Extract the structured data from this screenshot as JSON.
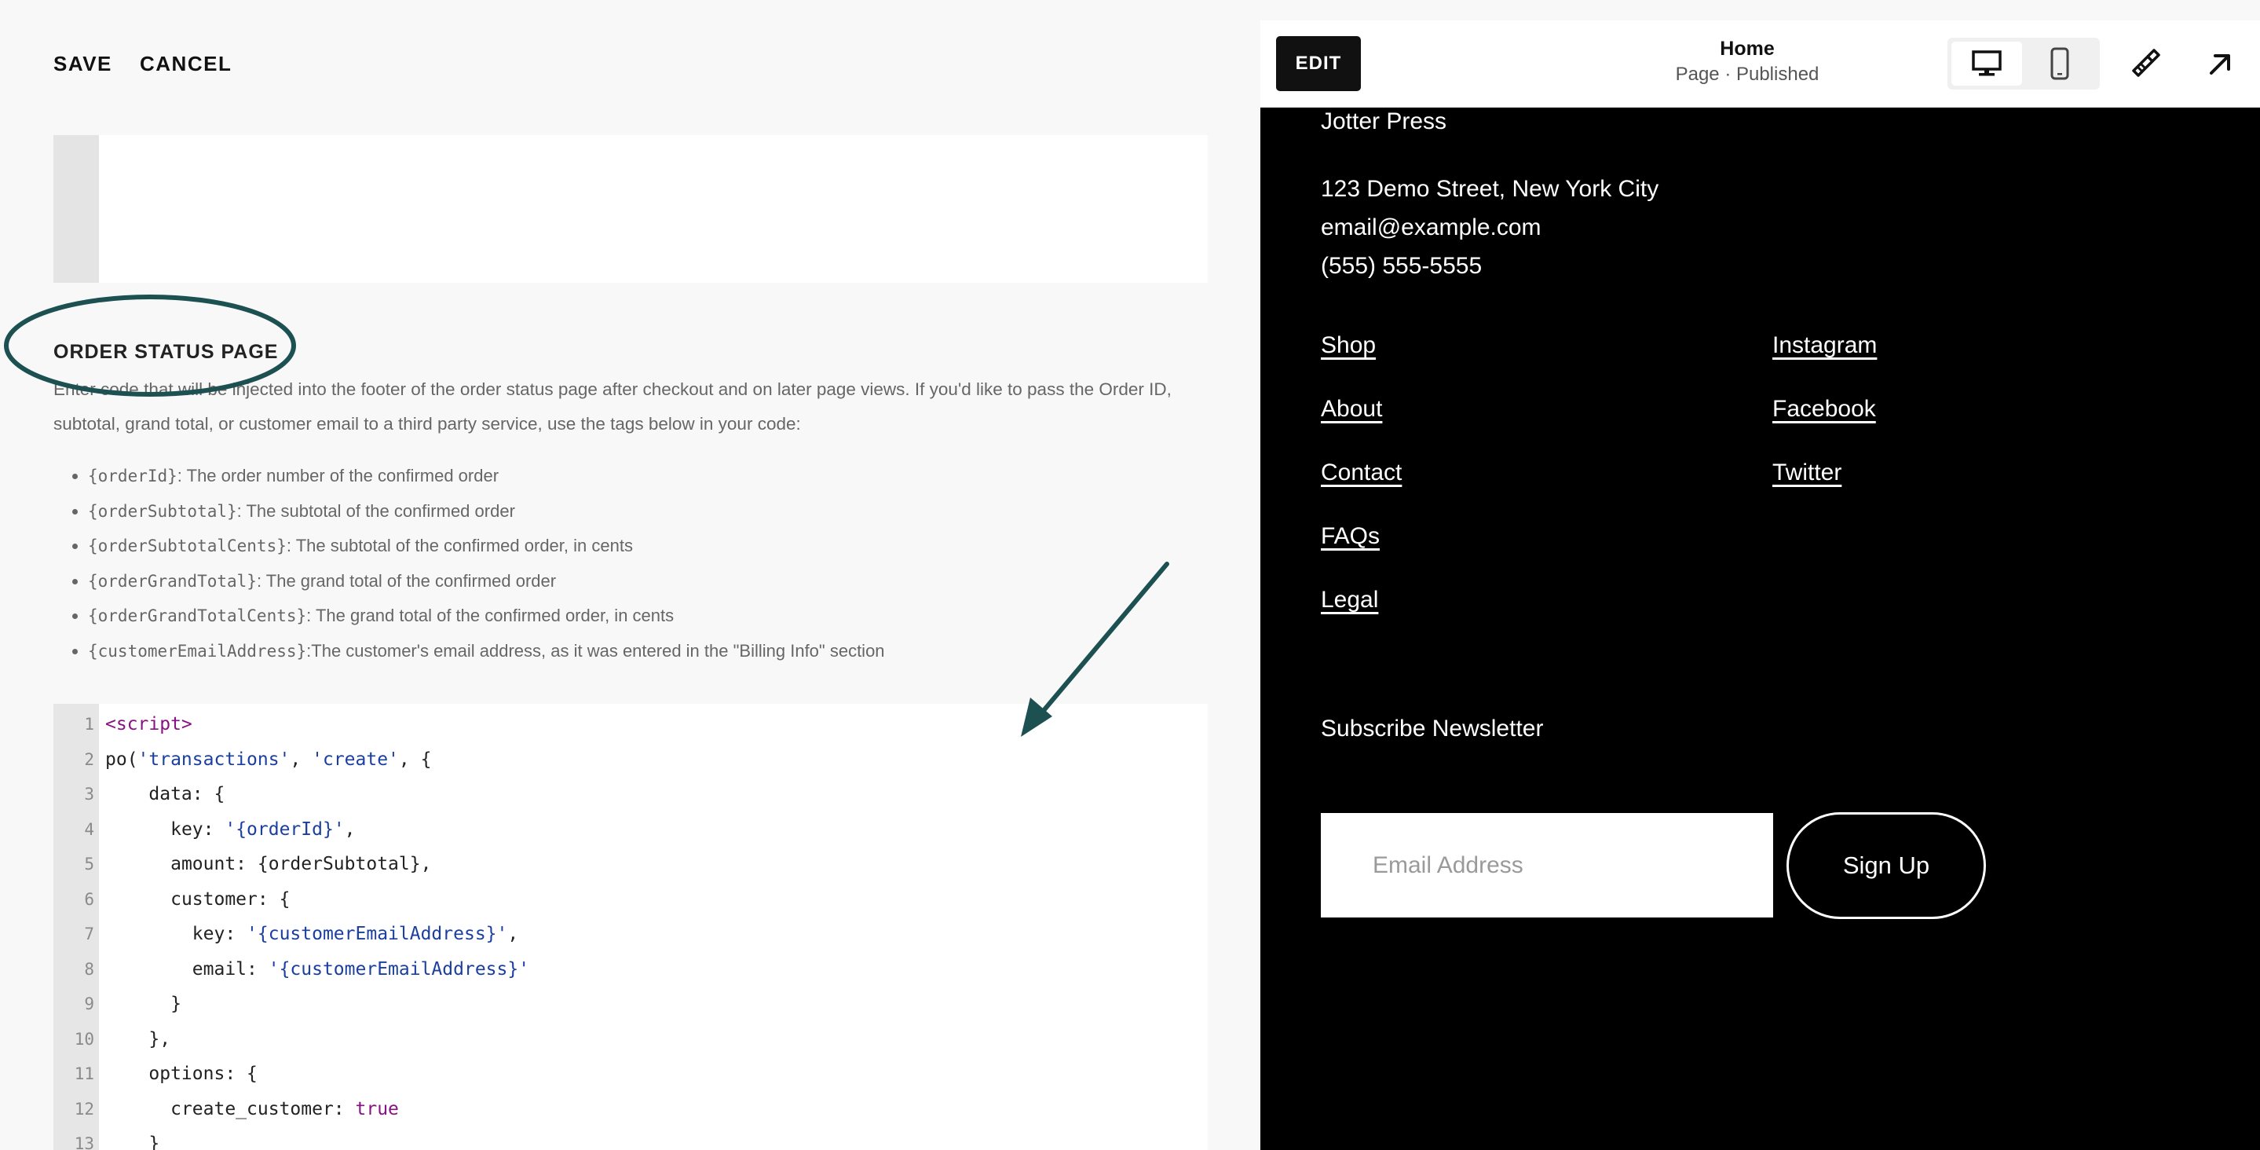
{
  "toolbar": {
    "save_label": "SAVE",
    "cancel_label": "CANCEL"
  },
  "order_status": {
    "title": "ORDER STATUS PAGE",
    "description": "Enter code that will be injected into the footer of the order status page after checkout and on later page views. If you'd like to pass the Order ID, subtotal, grand total, or customer email to a third party service, use the tags below in your code:",
    "tags": [
      {
        "tag": "{orderId}",
        "desc": ": The order number of the confirmed order"
      },
      {
        "tag": "{orderSubtotal}",
        "desc": ": The subtotal of the confirmed order"
      },
      {
        "tag": "{orderSubtotalCents}",
        "desc": ": The subtotal of the confirmed order, in cents"
      },
      {
        "tag": "{orderGrandTotal}",
        "desc": ": The grand total of the confirmed order"
      },
      {
        "tag": "{orderGrandTotalCents}",
        "desc": ": The grand total of the confirmed order, in cents"
      },
      {
        "tag": "{customerEmailAddress}",
        "desc": ":The customer's email address, as it was entered in the \"Billing Info\" section"
      }
    ]
  },
  "code": {
    "lines": [
      {
        "n": "1",
        "indent": "",
        "parts": [
          [
            "tag",
            "<script>"
          ]
        ]
      },
      {
        "n": "2",
        "indent": "",
        "parts": [
          [
            "plain",
            "po("
          ],
          [
            "str",
            "'transactions'"
          ],
          [
            "plain",
            ", "
          ],
          [
            "str",
            "'create'"
          ],
          [
            "plain",
            ", {"
          ]
        ]
      },
      {
        "n": "3",
        "indent": "    ",
        "parts": [
          [
            "plain",
            "data: {"
          ]
        ]
      },
      {
        "n": "4",
        "indent": "      ",
        "parts": [
          [
            "plain",
            "key: "
          ],
          [
            "str",
            "'{orderId}'"
          ],
          [
            "plain",
            ","
          ]
        ]
      },
      {
        "n": "5",
        "indent": "      ",
        "parts": [
          [
            "plain",
            "amount: {orderSubtotal},"
          ]
        ]
      },
      {
        "n": "6",
        "indent": "      ",
        "parts": [
          [
            "plain",
            "customer: {"
          ]
        ]
      },
      {
        "n": "7",
        "indent": "        ",
        "parts": [
          [
            "plain",
            "key: "
          ],
          [
            "str",
            "'{customerEmailAddress}'"
          ],
          [
            "plain",
            ","
          ]
        ]
      },
      {
        "n": "8",
        "indent": "        ",
        "parts": [
          [
            "plain",
            "email: "
          ],
          [
            "str",
            "'{customerEmailAddress}'"
          ]
        ]
      },
      {
        "n": "9",
        "indent": "      ",
        "parts": [
          [
            "plain",
            "}"
          ]
        ]
      },
      {
        "n": "10",
        "indent": "    ",
        "parts": [
          [
            "plain",
            "},"
          ]
        ]
      },
      {
        "n": "11",
        "indent": "    ",
        "parts": [
          [
            "plain",
            "options: {"
          ]
        ]
      },
      {
        "n": "12",
        "indent": "      ",
        "parts": [
          [
            "plain",
            "create_customer: "
          ],
          [
            "kw",
            "true"
          ]
        ]
      },
      {
        "n": "13",
        "indent": "    ",
        "parts": [
          [
            "plain",
            "}"
          ]
        ]
      }
    ]
  },
  "preview": {
    "edit_label": "EDIT",
    "page_name": "Home",
    "page_status": "Page · Published",
    "site_name": "Jotter Press",
    "address": [
      "123 Demo Street, New York City",
      "email@example.com",
      "(555) 555-5555"
    ],
    "nav_left": [
      "Shop",
      "About",
      "Contact",
      "FAQs",
      "Legal"
    ],
    "nav_right": [
      "Instagram",
      "Facebook",
      "Twitter"
    ],
    "newsletter_title": "Subscribe Newsletter",
    "email_placeholder": "Email Address",
    "signup_label": "Sign Up"
  },
  "colors": {
    "annotation": "#1d5050",
    "code_tag": "#881280",
    "code_string": "#1a3fa0",
    "code_keyword": "#881280"
  },
  "icons": [
    "desktop-icon",
    "mobile-icon",
    "brush-icon",
    "arrow-up-right-icon"
  ]
}
